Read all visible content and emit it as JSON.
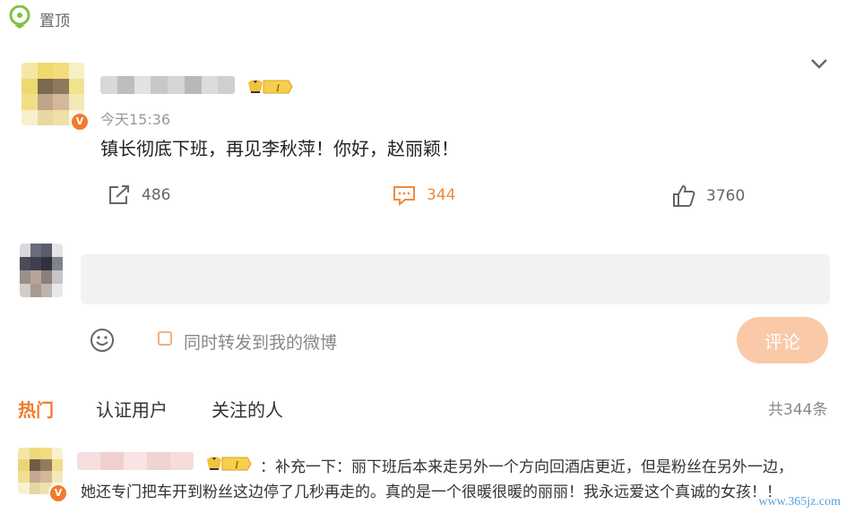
{
  "pin": {
    "label": "置顶",
    "icon": "pin-icon"
  },
  "post": {
    "time": "今天15:36",
    "text": "镇长彻底下班，再见李秋萍！你好，赵丽颖！",
    "level_badge": "I",
    "actions": {
      "repost": {
        "icon": "repost-icon",
        "count": "486"
      },
      "comment": {
        "icon": "comment-icon",
        "count": "344"
      },
      "like": {
        "icon": "like-icon",
        "count": "3760"
      }
    }
  },
  "composer": {
    "placeholder": "",
    "emoji_icon": "emoji-icon",
    "forward_label": "同时转发到我的微博",
    "submit_label": "评论"
  },
  "tabs": [
    {
      "label": "热门",
      "active": true
    },
    {
      "label": "认证用户",
      "active": false
    },
    {
      "label": "关注的人",
      "active": false
    }
  ],
  "total_label": "共344条",
  "reply": {
    "level_badge": "I",
    "line1": "：补充一下：丽下班后本来走另外一个方向回酒店更近，但是粉丝在另外一边，",
    "line2": "她还专门把车开到粉丝这边停了几秒再走的。真的是一个很暖很暖的丽丽！我永远爱这个真诚的女孩！！"
  },
  "watermark": "www.365jz.com",
  "colors": {
    "accent": "#f07b2c",
    "submit_bg": "#f9c9a8",
    "input_bg": "#f2f2f2",
    "verified": "#f37a2a"
  }
}
